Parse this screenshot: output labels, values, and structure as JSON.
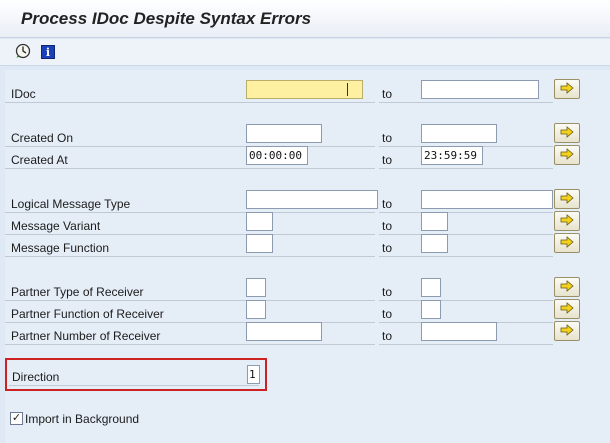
{
  "window": {
    "title": "Process IDoc Despite Syntax Errors"
  },
  "toolbar": {
    "execute_icon": "execute-icon",
    "info_icon": "info-icon"
  },
  "selection": {
    "to_label": "to",
    "rows": [
      {
        "id": "idoc",
        "label": "IDoc",
        "from": "",
        "to": ""
      },
      {
        "id": "created-on",
        "label": "Created On",
        "from": "",
        "to": ""
      },
      {
        "id": "created-at",
        "label": "Created At",
        "from": "00:00:00",
        "to": "23:59:59"
      },
      {
        "id": "logical-message-type",
        "label": "Logical Message Type",
        "from": "",
        "to": ""
      },
      {
        "id": "message-variant",
        "label": "Message Variant",
        "from": "",
        "to": ""
      },
      {
        "id": "message-function",
        "label": "Message Function",
        "from": "",
        "to": ""
      },
      {
        "id": "partner-type",
        "label": "Partner Type of Receiver",
        "from": "",
        "to": ""
      },
      {
        "id": "partner-function",
        "label": "Partner Function of Receiver",
        "from": "",
        "to": ""
      },
      {
        "id": "partner-number",
        "label": "Partner Number of Receiver",
        "from": "",
        "to": ""
      }
    ]
  },
  "direction": {
    "label": "Direction",
    "value": "1"
  },
  "options": {
    "import_background_label": "Import in Background",
    "import_background_checked": "✓"
  },
  "colors": {
    "required_field": "#fdf0a0",
    "highlight_border": "#cc2222",
    "background": "#dfe9f5"
  }
}
